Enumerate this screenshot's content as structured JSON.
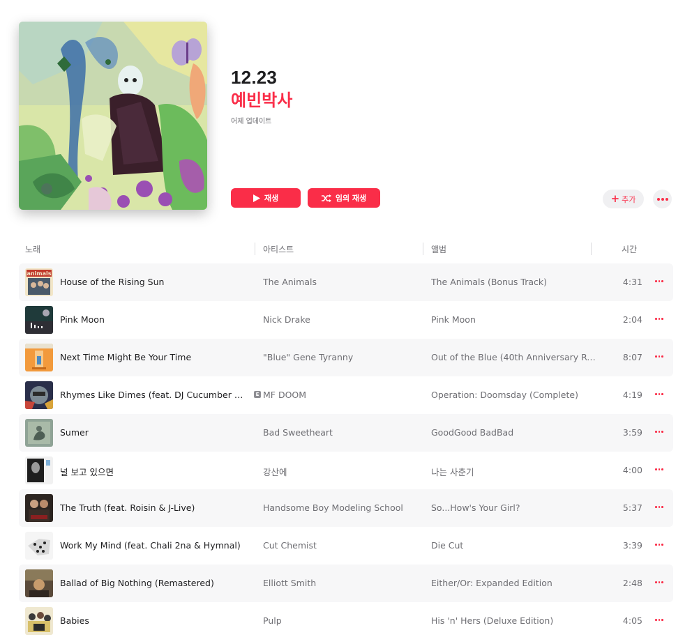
{
  "playlist": {
    "title": "12.23",
    "curator": "예빈박사",
    "updated": "어제 업데이트"
  },
  "actions": {
    "play_label": "재생",
    "shuffle_label": "임의 재생",
    "add_label": "추가",
    "play_icon": "play-icon",
    "shuffle_icon": "shuffle-icon",
    "more_icon": "more-icon"
  },
  "columns": {
    "song": "노래",
    "artist": "아티스트",
    "album": "앨범",
    "time": "시간"
  },
  "colors": {
    "accent": "#fa2d48",
    "secondary_text": "#6e6e73",
    "row_alt": "#f7f7f8"
  },
  "tracks": [
    {
      "title": "House of the Rising Sun",
      "artist": "The Animals",
      "album": "The Animals (Bonus Track)",
      "time": "4:31",
      "explicit": false
    },
    {
      "title": "Pink Moon",
      "artist": "Nick Drake",
      "album": "Pink Moon",
      "time": "2:04",
      "explicit": false
    },
    {
      "title": "Next Time Might Be Your Time",
      "artist": "\"Blue\" Gene Tyranny",
      "album": "Out of the Blue (40th Anniversary Re...",
      "time": "8:07",
      "explicit": false
    },
    {
      "title": "Rhymes Like Dimes (feat. DJ Cucumber Sli...",
      "artist": "MF DOOM",
      "album": "Operation: Doomsday (Complete)",
      "time": "4:19",
      "explicit": true,
      "explicit_mark": "E"
    },
    {
      "title": "Sumer",
      "artist": "Bad Sweetheart",
      "album": "GoodGood BadBad",
      "time": "3:59",
      "explicit": false
    },
    {
      "title": "널 보고 있으면",
      "artist": "강산에",
      "album": "나는 사춘기",
      "time": "4:00",
      "explicit": false
    },
    {
      "title": "The Truth (feat. Roisin & J-Live)",
      "artist": "Handsome Boy Modeling School",
      "album": "So...How's Your Girl?",
      "time": "5:37",
      "explicit": false
    },
    {
      "title": "Work My Mind (feat. Chali 2na & Hymnal)",
      "artist": "Cut Chemist",
      "album": "Die Cut",
      "time": "3:39",
      "explicit": false
    },
    {
      "title": "Ballad of Big Nothing (Remastered)",
      "artist": "Elliott Smith",
      "album": "Either/Or: Expanded Edition",
      "time": "2:48",
      "explicit": false
    },
    {
      "title": "Babies",
      "artist": "Pulp",
      "album": "His 'n' Hers (Deluxe Edition)",
      "time": "4:05",
      "explicit": false
    }
  ]
}
